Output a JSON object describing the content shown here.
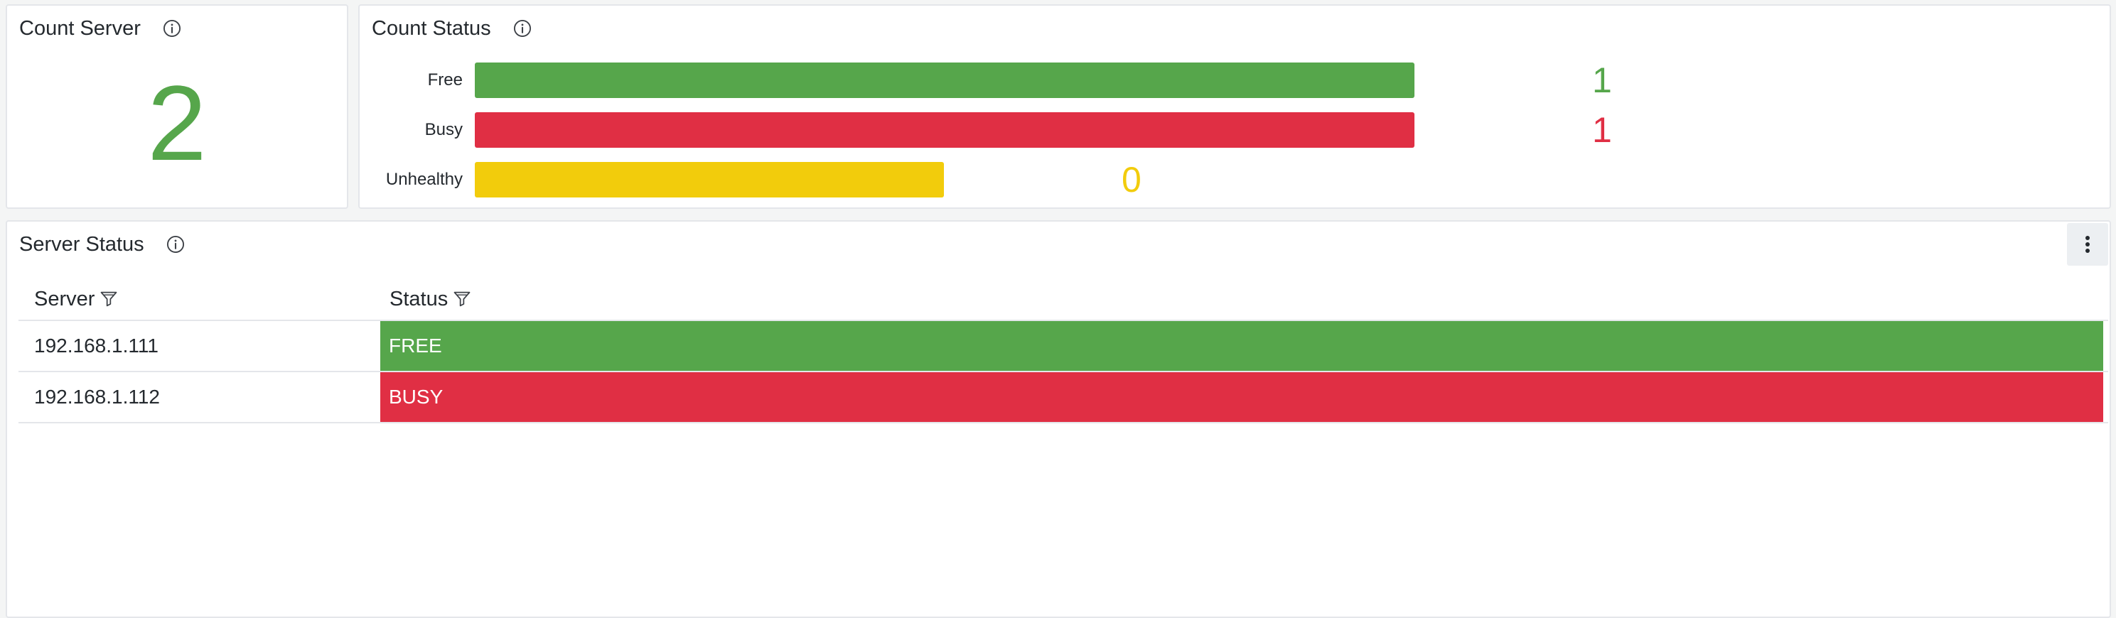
{
  "colors": {
    "green": "#56a64b",
    "red": "#e02f44",
    "yellow": "#f2cc0c",
    "text": "#24292e",
    "border": "#e4e6ea",
    "background": "#f4f5f5"
  },
  "count_server": {
    "title": "Count Server",
    "info_icon": "info-circle-icon",
    "value": "2"
  },
  "count_status": {
    "title": "Count Status",
    "info_icon": "info-circle-icon",
    "max": 1,
    "bars": [
      {
        "label": "Free",
        "value": 1,
        "display": "1",
        "color": "#56a64b"
      },
      {
        "label": "Busy",
        "value": 1,
        "display": "1",
        "color": "#e02f44"
      },
      {
        "label": "Unhealthy",
        "value": 0,
        "display": "0",
        "color": "#f2cc0c"
      }
    ]
  },
  "server_status": {
    "title": "Server Status",
    "info_icon": "info-circle-icon",
    "menu_icon": "more-vertical-icon",
    "columns": [
      {
        "label": "Server",
        "icon": "filter-icon"
      },
      {
        "label": "Status",
        "icon": "filter-icon"
      }
    ],
    "rows": [
      {
        "server": "192.168.1.111",
        "status": "FREE",
        "color": "#56a64b"
      },
      {
        "server": "192.168.1.112",
        "status": "BUSY",
        "color": "#e02f44"
      }
    ]
  }
}
